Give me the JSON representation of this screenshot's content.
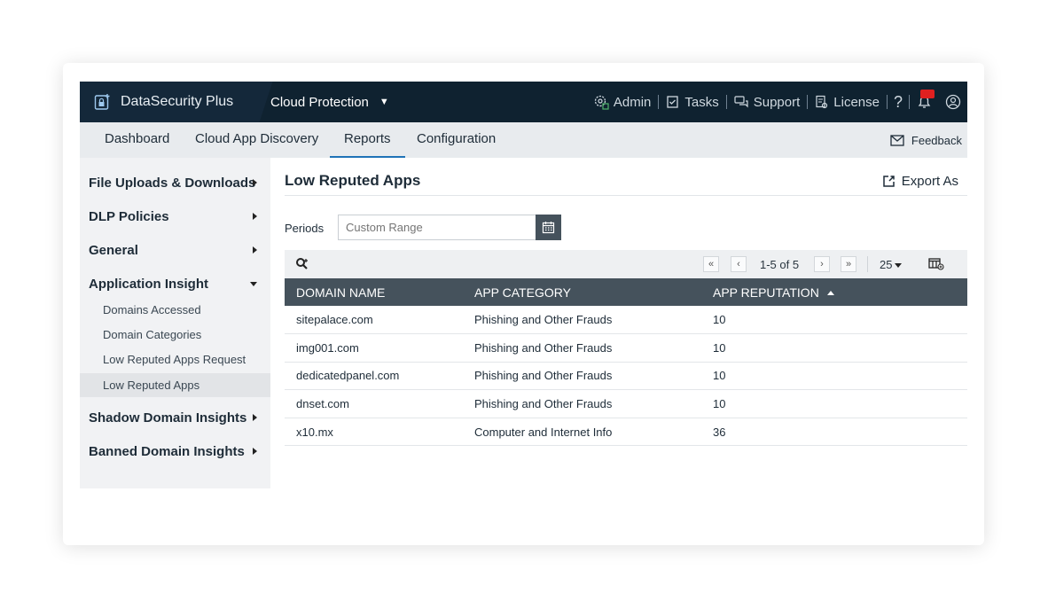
{
  "topbar": {
    "brand": "DataSecurity Plus",
    "product": "Cloud Protection",
    "links": {
      "admin": "Admin",
      "tasks": "Tasks",
      "support": "Support",
      "license": "License"
    }
  },
  "subnav": {
    "tabs": [
      "Dashboard",
      "Cloud App Discovery",
      "Reports",
      "Configuration"
    ],
    "active_tab": "Reports",
    "feedback": "Feedback"
  },
  "sidebar": {
    "sections": [
      {
        "label": "File Uploads & Downloads"
      },
      {
        "label": "DLP Policies"
      },
      {
        "label": "General"
      },
      {
        "label": "Application Insight"
      },
      {
        "label": "Shadow Domain Insights"
      },
      {
        "label": "Banned Domain Insights"
      }
    ],
    "application_insight_items": [
      "Domains Accessed",
      "Domain Categories",
      "Low Reputed Apps Request",
      "Low Reputed Apps"
    ],
    "active_item": "Low Reputed Apps"
  },
  "main": {
    "title": "Low Reputed Apps",
    "export_label": "Export As",
    "periods_label": "Periods",
    "periods_placeholder": "Custom Range",
    "pagination": {
      "range": "1-5 of 5",
      "page_size": "25"
    },
    "columns": [
      "DOMAIN NAME",
      "APP CATEGORY",
      "APP REPUTATION"
    ],
    "rows": [
      [
        "sitepalace.com",
        "Phishing and Other Frauds",
        "10"
      ],
      [
        "img001.com",
        "Phishing and Other Frauds",
        "10"
      ],
      [
        "dedicatedpanel.com",
        "Phishing and Other Frauds",
        "10"
      ],
      [
        "dnset.com",
        "Phishing and Other Frauds",
        "10"
      ],
      [
        "x10.mx",
        "Computer and Internet Info",
        "36"
      ]
    ]
  },
  "colors": {
    "topbar": "#0f2230",
    "table_header": "#45525c",
    "accent": "#1f73b7",
    "badge": "#e02020"
  }
}
